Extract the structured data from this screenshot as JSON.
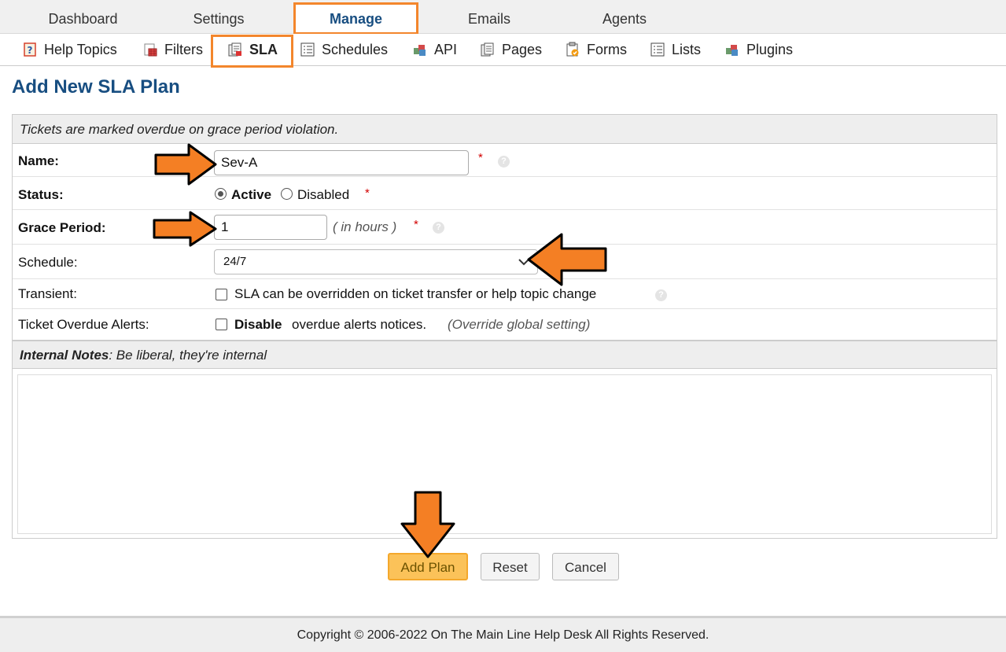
{
  "top_nav": {
    "tabs": [
      {
        "label": "Dashboard"
      },
      {
        "label": "Settings"
      },
      {
        "label": "Manage"
      },
      {
        "label": "Emails"
      },
      {
        "label": "Agents"
      }
    ],
    "active": "Manage"
  },
  "sub_nav": {
    "items": [
      {
        "label": "Help Topics",
        "icon": "help-topics-icon"
      },
      {
        "label": "Filters",
        "icon": "filters-icon"
      },
      {
        "label": "SLA",
        "icon": "sla-icon"
      },
      {
        "label": "Schedules",
        "icon": "schedules-icon"
      },
      {
        "label": "API",
        "icon": "api-icon"
      },
      {
        "label": "Pages",
        "icon": "pages-icon"
      },
      {
        "label": "Forms",
        "icon": "forms-icon"
      },
      {
        "label": "Lists",
        "icon": "lists-icon"
      },
      {
        "label": "Plugins",
        "icon": "plugins-icon"
      }
    ],
    "active": "SLA"
  },
  "page": {
    "title": "Add New SLA Plan",
    "info_header": "Tickets are marked overdue on grace period violation.",
    "name": {
      "label": "Name:",
      "value": "Sev-A",
      "required": "*"
    },
    "status": {
      "label": "Status:",
      "option_active": "Active",
      "option_disabled": "Disabled",
      "selected": "Active",
      "required": "*"
    },
    "grace_period": {
      "label": "Grace Period:",
      "value": "1",
      "unit": "( in hours )",
      "required": "*"
    },
    "schedule": {
      "label": "Schedule:",
      "value": "24/7"
    },
    "transient": {
      "label": "Transient:",
      "text": "SLA can be overridden on ticket transfer or help topic change",
      "checked": false
    },
    "overdue_alerts": {
      "label": "Ticket Overdue Alerts:",
      "text_bold": "Disable",
      "text": "overdue alerts notices.",
      "note": "(Override global setting)",
      "checked": false
    },
    "notes_header": {
      "bold": "Internal Notes",
      "text": ": Be liberal, they're internal"
    },
    "help_glyph": "?"
  },
  "buttons": {
    "add": "Add Plan",
    "reset": "Reset",
    "cancel": "Cancel"
  },
  "footer": {
    "copyright": "Copyright © 2006-2022 On The Main Line Help Desk All Rights Reserved."
  },
  "colors": {
    "accent": "#184e81",
    "highlight": "#f3862c",
    "primary_button": "#fbc259"
  }
}
